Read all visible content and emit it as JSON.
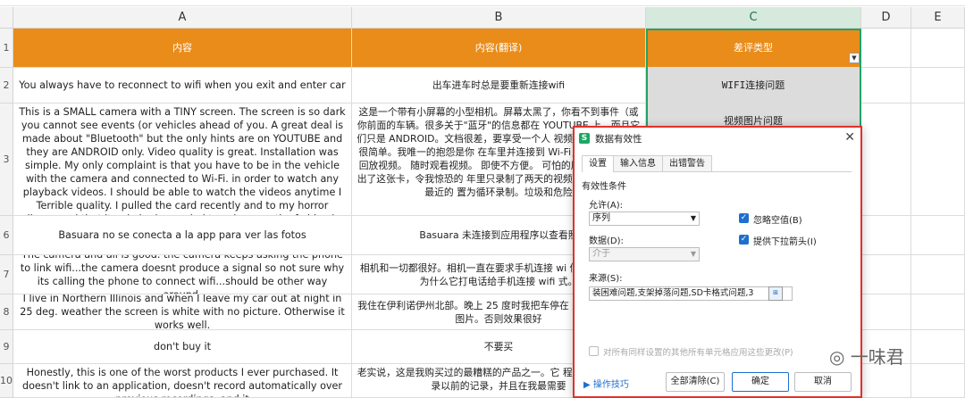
{
  "columns": [
    "A",
    "B",
    "C",
    "D",
    "E"
  ],
  "rows": [
    {
      "num": "1",
      "a": "内容",
      "b": "内容(翻译)",
      "c": "差评类型",
      "header": true
    },
    {
      "num": "2",
      "a": "You always have to reconnect to wifi when you exit and enter car",
      "b": "出车进车时总是要重新连接wifi",
      "c": "WIFI连接问题"
    },
    {
      "num": "3",
      "a": "This is a SMALL camera with a TINY screen. The screen is so dark you cannot see events (or vehicles ahead of you. A great deal is made about \"Bluetooth\" but the only hints are on YOUTUBE and they are ANDROID only. Video quality is great. Installation was simple. My only complaint is that you have to be in the vehicle with the camera and connected to Wi-Fi. in order to watch any playback videos. I should be able to watch the videos anytime I Terrible quality. I pulled the card recently and to my horror discovered that it only had recorded two days worth of video in the last 2 years. Neither day was recent. I did have it set to loop recording. Junk and dangerous",
      "b": "这是一个带有小屏幕的小型相机。屏幕太黑了，你看不到事件（或你前面的车辆。很多关于\"蓝牙\"的信息都在 YOUTUBE 上，而且它们只是 ANDROID。文档很差，要享受一个人 视频质量很棒。安装很简单。我唯一的抱怨是你 在车里并连接到 Wi-Fi，才能观看任何回放视频。 随时观看视频。 即使不方便。 可怕的质量。我最近取出了这张卡，令我惊恐的 年里只录制了两天的视频。这两天都不是最近的 置为循环录制。垃圾和危险",
      "c": "视频图片问题"
    },
    {
      "num": "6",
      "a": "Basuara no se conecta a la app para ver las fotos",
      "b": "Basuara 未连接到应用程序以查看照"
    },
    {
      "num": "7",
      "a": "The camera and all is good. the camera keeps asking the phone to link wifi...the camera doesnt produce a signal so not sure why its calling the phone to connect wifi...should be other way around.",
      "b": "相机和一切都很好。相机一直在要求手机连接 wi 信号所以不知道为什么它打电话给手机连接 wifi 式。"
    },
    {
      "num": "8",
      "a": "I live in Northern Illinois and when I leave my car out at night in 25 deg. weather the screen is white with no picture. Otherwise it works well.",
      "b": "我住在伊利诺伊州北部。晚上 25 度时我把车停在 是白色的，没有图片。否则效果很好"
    },
    {
      "num": "9",
      "a": "don't buy it",
      "b": "不要买"
    },
    {
      "num": "10",
      "a": "Honestly, this is one of the worst products I ever purchased. It doesn't link to an application, doesn't record automatically over previous recordings, and it",
      "b": "老实说，这是我购买过的最糟糕的产品之一。它 程序，不会自动记录以前的记录，并且在我最需要"
    }
  ],
  "dialog": {
    "title": "数据有效性",
    "tabs": [
      "设置",
      "输入信息",
      "出错警告"
    ],
    "section": "有效性条件",
    "allow_label": "允许(A):",
    "allow_value": "序列",
    "data_label": "数据(D):",
    "data_value": "介于",
    "ignore_blank": "忽略空值(B)",
    "dropdown": "提供下拉箭头(I)",
    "source_label": "来源(S):",
    "source_value": "装困难问题,支架掉落问题,SD卡格式问题,3",
    "apply_note": "对所有同样设置的其他所有单元格应用这些更改(P)",
    "tips": "操作技巧",
    "clear_all": "全部清除(C)",
    "ok": "确定",
    "cancel": "取消"
  },
  "watermark": "一味君"
}
